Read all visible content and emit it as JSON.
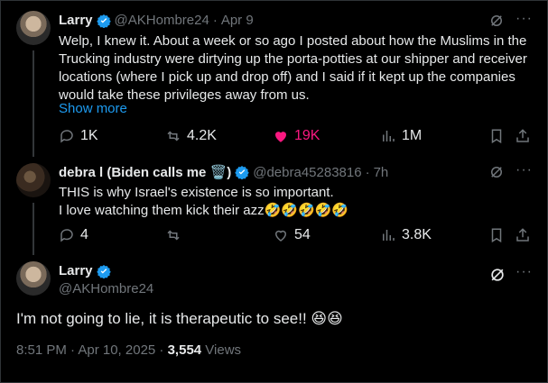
{
  "post1": {
    "name": "Larry",
    "handle": "@AKHombre24",
    "sep": "·",
    "date": "Apr 9",
    "text": "Welp, I knew it. About a week or so ago I posted about how the Muslims in the Trucking industry were dirtying up the porta-potties at our shipper and receiver locations (where I pick up and drop off) and I said if it kept up the companies would take these privileges away from us.",
    "show_more": "Show more",
    "replies": "1K",
    "reposts": "4.2K",
    "likes": "19K",
    "views": "1M"
  },
  "post2": {
    "name": "debra l (Biden calls me 🗑️)",
    "handle": "@debra45283816",
    "sep": "·",
    "date": "7h",
    "line1": "THIS is why Israel's existence is so important.",
    "line2": "I love watching them kick their azz🤣🤣🤣🤣🤣",
    "replies": "4",
    "reposts": "",
    "likes": "54",
    "views": "3.8K"
  },
  "post3": {
    "name": "Larry",
    "handle": "@AKHombre24",
    "text": "I'm not going to lie, it is therapeutic to see!! 😆😆",
    "time": "8:51 PM · Apr 10, 2025 · ",
    "views_count": "3,554",
    "views_label": " Views"
  },
  "colors": {
    "accent": "#1d9bf0",
    "like": "#f91880",
    "muted": "#71767b"
  }
}
